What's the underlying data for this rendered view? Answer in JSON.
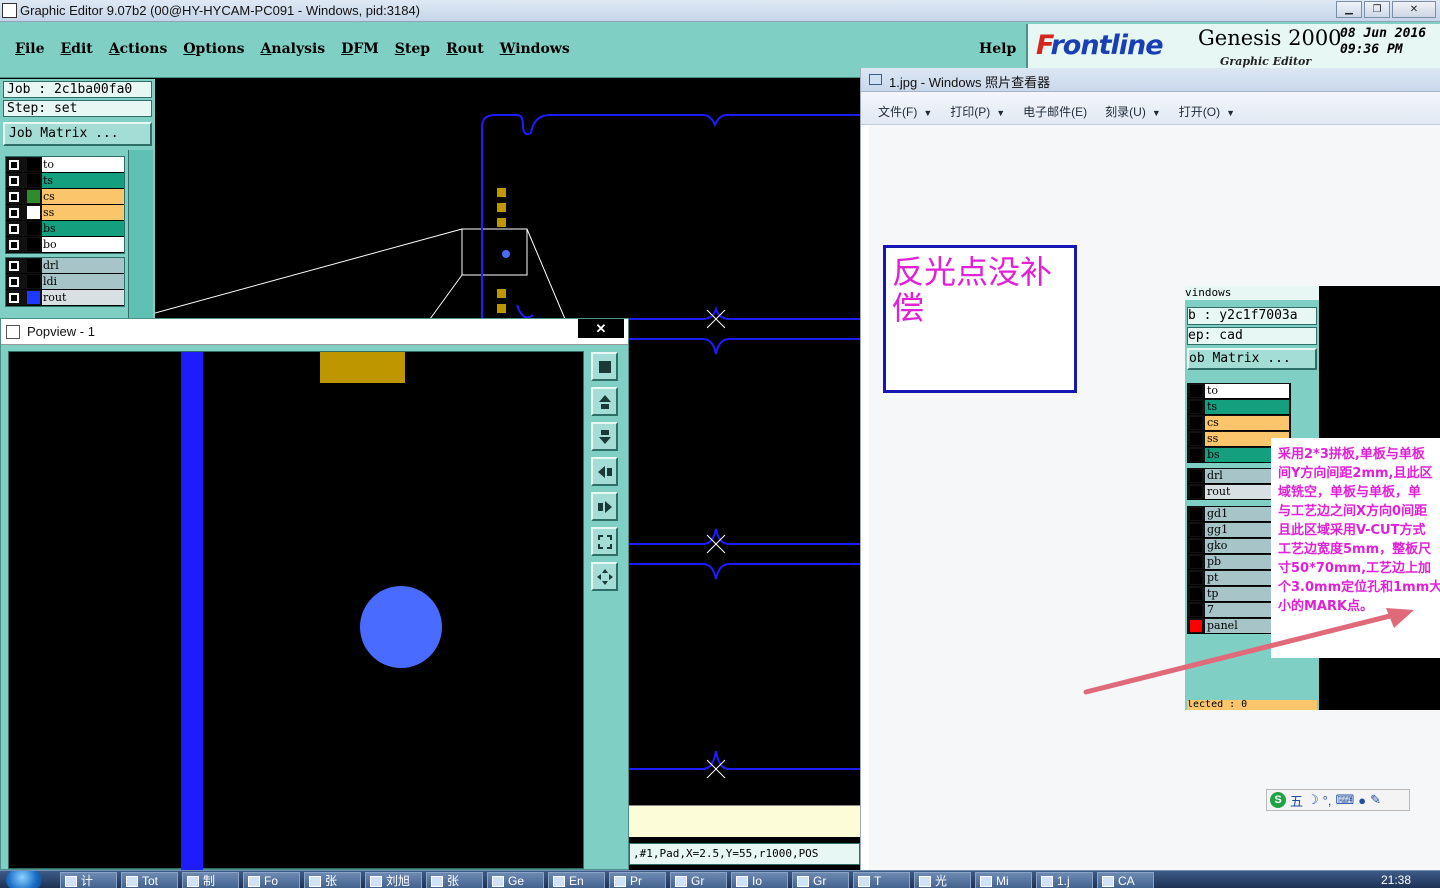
{
  "window": {
    "title": "Graphic Editor 9.07b2 (00@HY-HYCAM-PC091 - Windows, pid:3184)",
    "minimize_glyph": "▁",
    "restore_glyph": "❐",
    "close_glyph": "✕"
  },
  "menu": {
    "items": [
      {
        "key": "F",
        "rest": "ile"
      },
      {
        "key": "E",
        "rest": "dit"
      },
      {
        "key": "A",
        "rest": "ctions"
      },
      {
        "key": "O",
        "rest": "ptions"
      },
      {
        "key": "A",
        "rest": "nalysis"
      },
      {
        "key": "D",
        "rest": "FM"
      },
      {
        "key": "S",
        "rest": "tep"
      },
      {
        "key": "R",
        "rest": "out"
      },
      {
        "key": "W",
        "rest": "indows"
      }
    ],
    "help": "Help"
  },
  "brand": {
    "logo_f": "F",
    "logo_rest": "rontline",
    "product": "Genesis 2000",
    "subtitle": "Graphic Editor",
    "date": "08 Jun 2016",
    "time": "09:36 PM"
  },
  "job_panel": {
    "job": "Job : 2c1ba00fa0",
    "step": "Step: set",
    "matrix_button": "Job Matrix ..."
  },
  "layers_group1": [
    {
      "name": "to",
      "color": "#ffffff",
      "mark": "#000000"
    },
    {
      "name": "ts",
      "color": "#14a07f",
      "mark": "#000000"
    },
    {
      "name": "cs",
      "color": "#fbc56b",
      "mark": "#2e8b2e"
    },
    {
      "name": "ss",
      "color": "#fbc56b",
      "mark": "#ffffff"
    },
    {
      "name": "bs",
      "color": "#14a07f",
      "mark": "#000000"
    },
    {
      "name": "bo",
      "color": "#ffffff",
      "mark": "#000000"
    }
  ],
  "layers_group2": [
    {
      "name": "drl",
      "color": "#a7c4c8",
      "mark": "#000000"
    },
    {
      "name": "ldi",
      "color": "#a7c4c8",
      "mark": "#000000"
    },
    {
      "name": "rout",
      "color": "#d9e0e3",
      "mark": "#1c39ff"
    }
  ],
  "popview": {
    "title": "Popview - 1",
    "close_glyph": "✕",
    "tools": [
      "zoom-fit-icon",
      "pan-up-icon",
      "pan-down-icon",
      "pan-left-icon",
      "pan-right-icon",
      "zoom-in-icon",
      "zoom-out-icon"
    ]
  },
  "status": {
    "text": ",#1,Pad,X=2.5,Y=55,r1000,POS"
  },
  "photo_viewer": {
    "title": "1.jpg - Windows 照片查看器",
    "menus": [
      "文件(F)",
      "打印(P)",
      "电子邮件(E)",
      "刻录(U)",
      "打开(O)"
    ],
    "menu_has_arrow": [
      true,
      true,
      false,
      true,
      true
    ],
    "note": "反光点没补偿"
  },
  "embedded_genesis": {
    "title": "vindows",
    "job": "b : y2c1f7003a",
    "step": "ep: cad",
    "matrix_button": "ob Matrix ...",
    "layers_a": [
      {
        "name": "to",
        "color": "#ffffff",
        "swatch": "#000000"
      },
      {
        "name": "ts",
        "color": "#14a07f",
        "swatch": "#000000"
      },
      {
        "name": "cs",
        "color": "#fbc56b",
        "swatch": "#000000"
      },
      {
        "name": "ss",
        "color": "#fbc56b",
        "swatch": "#000000"
      },
      {
        "name": "bs",
        "color": "#14a07f",
        "swatch": "#000000"
      }
    ],
    "layers_b": [
      {
        "name": "drl",
        "color": "#a7c4c8",
        "swatch": "#000000"
      },
      {
        "name": "rout",
        "color": "#d9e0e3",
        "swatch": "#000000"
      }
    ],
    "layers_c": [
      {
        "name": "gd1",
        "color": "#a7c4c8",
        "swatch": "#000000"
      },
      {
        "name": "gg1",
        "color": "#a7c4c8",
        "swatch": "#000000"
      },
      {
        "name": "gko",
        "color": "#a7c4c8",
        "swatch": "#000000"
      },
      {
        "name": "pb",
        "color": "#a7c4c8",
        "swatch": "#000000"
      },
      {
        "name": "pt",
        "color": "#a7c4c8",
        "swatch": "#000000"
      },
      {
        "name": "tp",
        "color": "#a7c4c8",
        "swatch": "#000000"
      },
      {
        "name": "7",
        "color": "#a7c4c8",
        "swatch": "#000000"
      },
      {
        "name": "panel",
        "color": "#a7c4c8",
        "swatch": "#ff0000"
      }
    ],
    "bottom": "lected : 0"
  },
  "annotation": {
    "lines": [
      "采用2*3拼板,单板与单板",
      "间Y方向间距2mm,且此区",
      "域铣空，单板与单板，单",
      "与工艺边之间X方向0间距",
      "且此区域采用V-CUT方式",
      "工艺边宽度5mm，整板尺",
      "寸50*70mm,工艺边上加",
      "个3.0mm定位孔和1mm大",
      "小的MARK点。"
    ]
  },
  "ime": {
    "logo": "S",
    "label": "五"
  },
  "taskbar": {
    "items": [
      "计",
      "Tot",
      "制",
      "Fo",
      "张",
      "刘旭",
      "张",
      "Ge",
      "En",
      "Pr",
      "Gr",
      "Io",
      "Gr",
      "T",
      "光",
      "Mi",
      "1.j",
      "CA"
    ],
    "clock": "21:38"
  },
  "colors": {
    "genesis_panel": "#7fcfc5",
    "trace_blue": "#1c1cff",
    "pad_gold": "#bd9600",
    "pad_blue": "#4a6bff",
    "annotation_magenta": "#e021d6"
  }
}
